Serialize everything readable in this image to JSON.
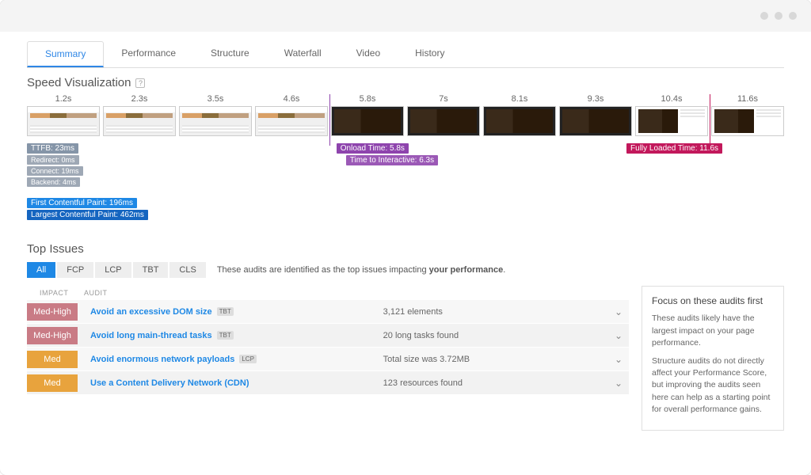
{
  "tabs": [
    "Summary",
    "Performance",
    "Structure",
    "Waterfall",
    "Video",
    "History"
  ],
  "active_tab": 0,
  "speed_viz": {
    "title": "Speed Visualization",
    "frames": [
      {
        "t": "1.2s",
        "style": "light"
      },
      {
        "t": "2.3s",
        "style": "light"
      },
      {
        "t": "3.5s",
        "style": "light"
      },
      {
        "t": "4.6s",
        "style": "light"
      },
      {
        "t": "5.8s",
        "style": "dark",
        "marker": "purple"
      },
      {
        "t": "7s",
        "style": "dark"
      },
      {
        "t": "8.1s",
        "style": "dark"
      },
      {
        "t": "9.3s",
        "style": "dark"
      },
      {
        "t": "10.4s",
        "style": "mixed"
      },
      {
        "t": "11.6s",
        "style": "mixed",
        "marker": "pink"
      }
    ],
    "left_badges": {
      "ttfb": "TTFB: 23ms",
      "redirect": "Redirect: 0ms",
      "connect": "Connect: 19ms",
      "backend": "Backend: 4ms",
      "fcp": "First Contentful Paint: 196ms",
      "lcp": "Largest Contentful Paint: 462ms"
    },
    "onload": "Onload Time: 5.8s",
    "tti": "Time to Interactive: 6.3s",
    "fully": "Fully Loaded Time: 11.6s"
  },
  "top": {
    "title": "Top Issues",
    "chips": [
      "All",
      "FCP",
      "LCP",
      "TBT",
      "CLS"
    ],
    "active_chip": 0,
    "blurb_pre": "These audits are identified as the top issues impacting ",
    "blurb_bold": "your performance",
    "col_impact": "IMPACT",
    "col_audit": "AUDIT",
    "issues": [
      {
        "impact": "Med-High",
        "cls": "mh",
        "audit": "Avoid an excessive DOM size",
        "tag": "TBT",
        "val": "3,121 elements"
      },
      {
        "impact": "Med-High",
        "cls": "mh",
        "audit": "Avoid long main-thread tasks",
        "tag": "TBT",
        "val": "20 long tasks found"
      },
      {
        "impact": "Med",
        "cls": "md",
        "audit": "Avoid enormous network payloads",
        "tag": "LCP",
        "val": "Total size was 3.72MB"
      },
      {
        "impact": "Med",
        "cls": "md",
        "audit": "Use a Content Delivery Network (CDN)",
        "tag": "",
        "val": "123 resources found"
      }
    ],
    "panel": {
      "title": "Focus on these audits first",
      "p1": "These audits likely have the largest impact on your page performance.",
      "p2": "Structure audits do not directly affect your Performance Score, but improving the audits seen here can help as a starting point for overall performance gains."
    }
  }
}
